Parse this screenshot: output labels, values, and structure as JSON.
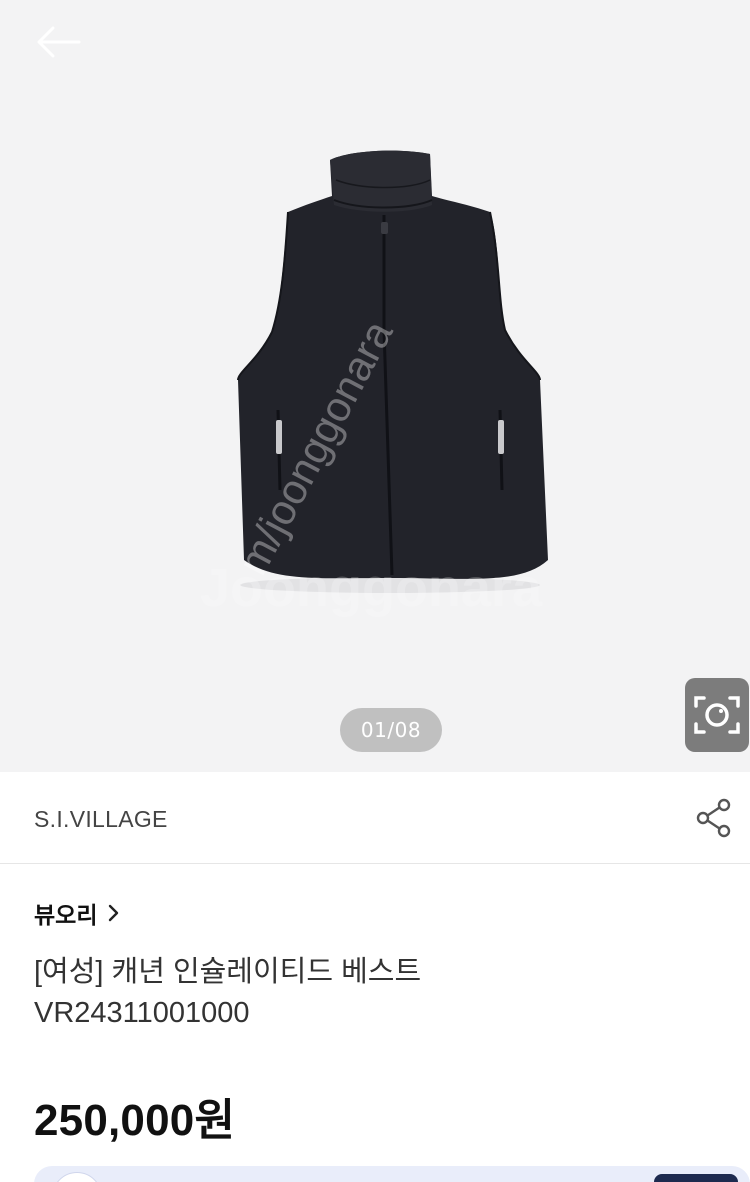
{
  "gallery": {
    "counter": "01/08",
    "watermark_primary": "m/joonggonara",
    "watermark_secondary": "Joonggonara",
    "icons": {
      "back": "arrow-left-icon",
      "lens": "camera-lens-icon"
    }
  },
  "brand": {
    "name": "S.I.VILLAGE",
    "share_icon": "share-icon"
  },
  "store": {
    "name": "뷰오리",
    "chevron_icon": "chevron-right-icon"
  },
  "product": {
    "title_line1": "[여성] 캐년 인슐레이티드 베스트",
    "title_line2": "VR24311001000",
    "price": "250,000원"
  },
  "colors": {
    "gallery_bg": "#f3f3f4",
    "vest": "#22232a",
    "counter_bg": "#969696",
    "banner_bg": "#e9edfa",
    "banner_button": "#1d2a4f"
  }
}
